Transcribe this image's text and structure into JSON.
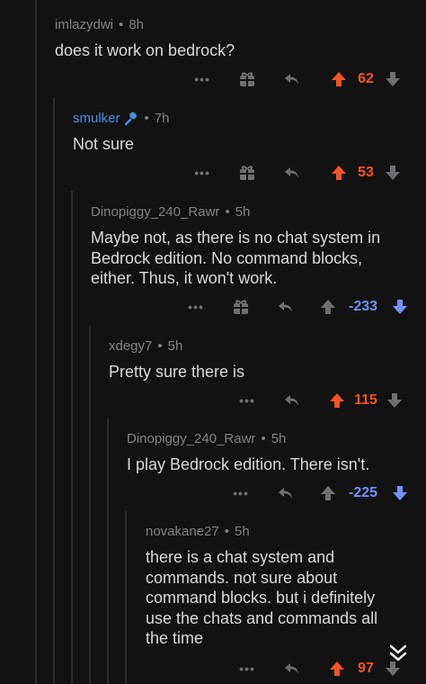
{
  "comments": [
    {
      "user": "imlazydwi",
      "time": "8h",
      "body": "does it work on bedrock?",
      "score": "62",
      "vote": "up",
      "user_color": "#818384"
    },
    {
      "user": "smulker",
      "time": "7h",
      "body": "Not sure",
      "score": "53",
      "vote": "up",
      "user_color": "#4a8fe0",
      "flair": "microphone-flair-icon"
    },
    {
      "user": "Dinopiggy_240_Rawr",
      "time": "5h",
      "body": "Maybe not, as there is no chat system in\nBedrock edition. No command blocks,\neither. Thus, it won't work.",
      "score": "-233",
      "vote": "down"
    },
    {
      "user": "xdegy7",
      "time": "5h",
      "body": "Pretty sure there is",
      "score": "115",
      "vote": "up"
    },
    {
      "user": "Dinopiggy_240_Rawr",
      "time": "5h",
      "body": "I play Bedrock edition. There isn't.",
      "score": "-225",
      "vote": "down"
    },
    {
      "user": "novakane27",
      "time": "5h",
      "body": "there is a chat system and\ncommands. not sure about\ncommand blocks. but i definitely\nuse the chats and commands all\nthe time",
      "score": "97",
      "vote": "up"
    }
  ],
  "separator": "•",
  "more_label": "•••",
  "colors": {
    "background": "#121212",
    "upvote": "#f45425",
    "downvote": "#7193ff",
    "text": "#d7dadc",
    "meta": "#818384",
    "thread_line": "#2c2c2e"
  }
}
